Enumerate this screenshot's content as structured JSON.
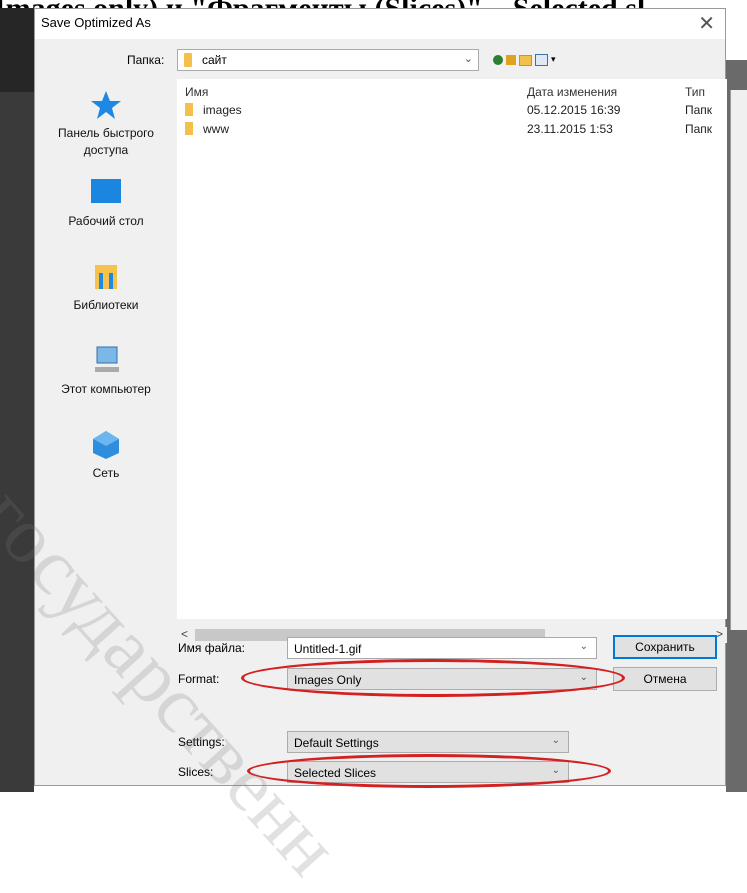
{
  "heading": "Images only) и \"Фрагменты (Slices)\" – Selected sl",
  "dialog": {
    "title": "Save Optimized As",
    "close_glyph": "✕"
  },
  "folder_bar": {
    "label": "Папка:",
    "current": "сайт",
    "dropdown_glyph": "⌄"
  },
  "places": [
    {
      "label": "Панель быстрого доступа",
      "icon": "star-icon"
    },
    {
      "label": "Рабочий стол",
      "icon": "desktop-icon"
    },
    {
      "label": "Библиотеки",
      "icon": "libraries-icon"
    },
    {
      "label": "Этот компьютер",
      "icon": "computer-icon"
    },
    {
      "label": "Сеть",
      "icon": "network-icon"
    }
  ],
  "file_list": {
    "columns": {
      "name": "Имя",
      "date": "Дата изменения",
      "type": "Тип"
    },
    "rows": [
      {
        "name": "images",
        "date": "05.12.2015 16:39",
        "type": "Папк"
      },
      {
        "name": "www",
        "date": "23.11.2015 1:53",
        "type": "Папк"
      }
    ],
    "scroll_left": "<",
    "scroll_right": ">"
  },
  "form": {
    "filename_label": "Имя файла:",
    "filename_value": "Untitled-1.gif",
    "format_label": "Format:",
    "format_value": "Images Only",
    "settings_label": "Settings:",
    "settings_value": "Default Settings",
    "slices_label": "Slices:",
    "slices_value": "Selected Slices",
    "dropdown_glyph": "⌄"
  },
  "buttons": {
    "save": "Сохранить",
    "cancel": "Отмена"
  },
  "watermark": "государственн",
  "colors": {
    "highlight_oval": "#d42020",
    "folder": "#f3c14b",
    "accent": "#0078d7"
  }
}
